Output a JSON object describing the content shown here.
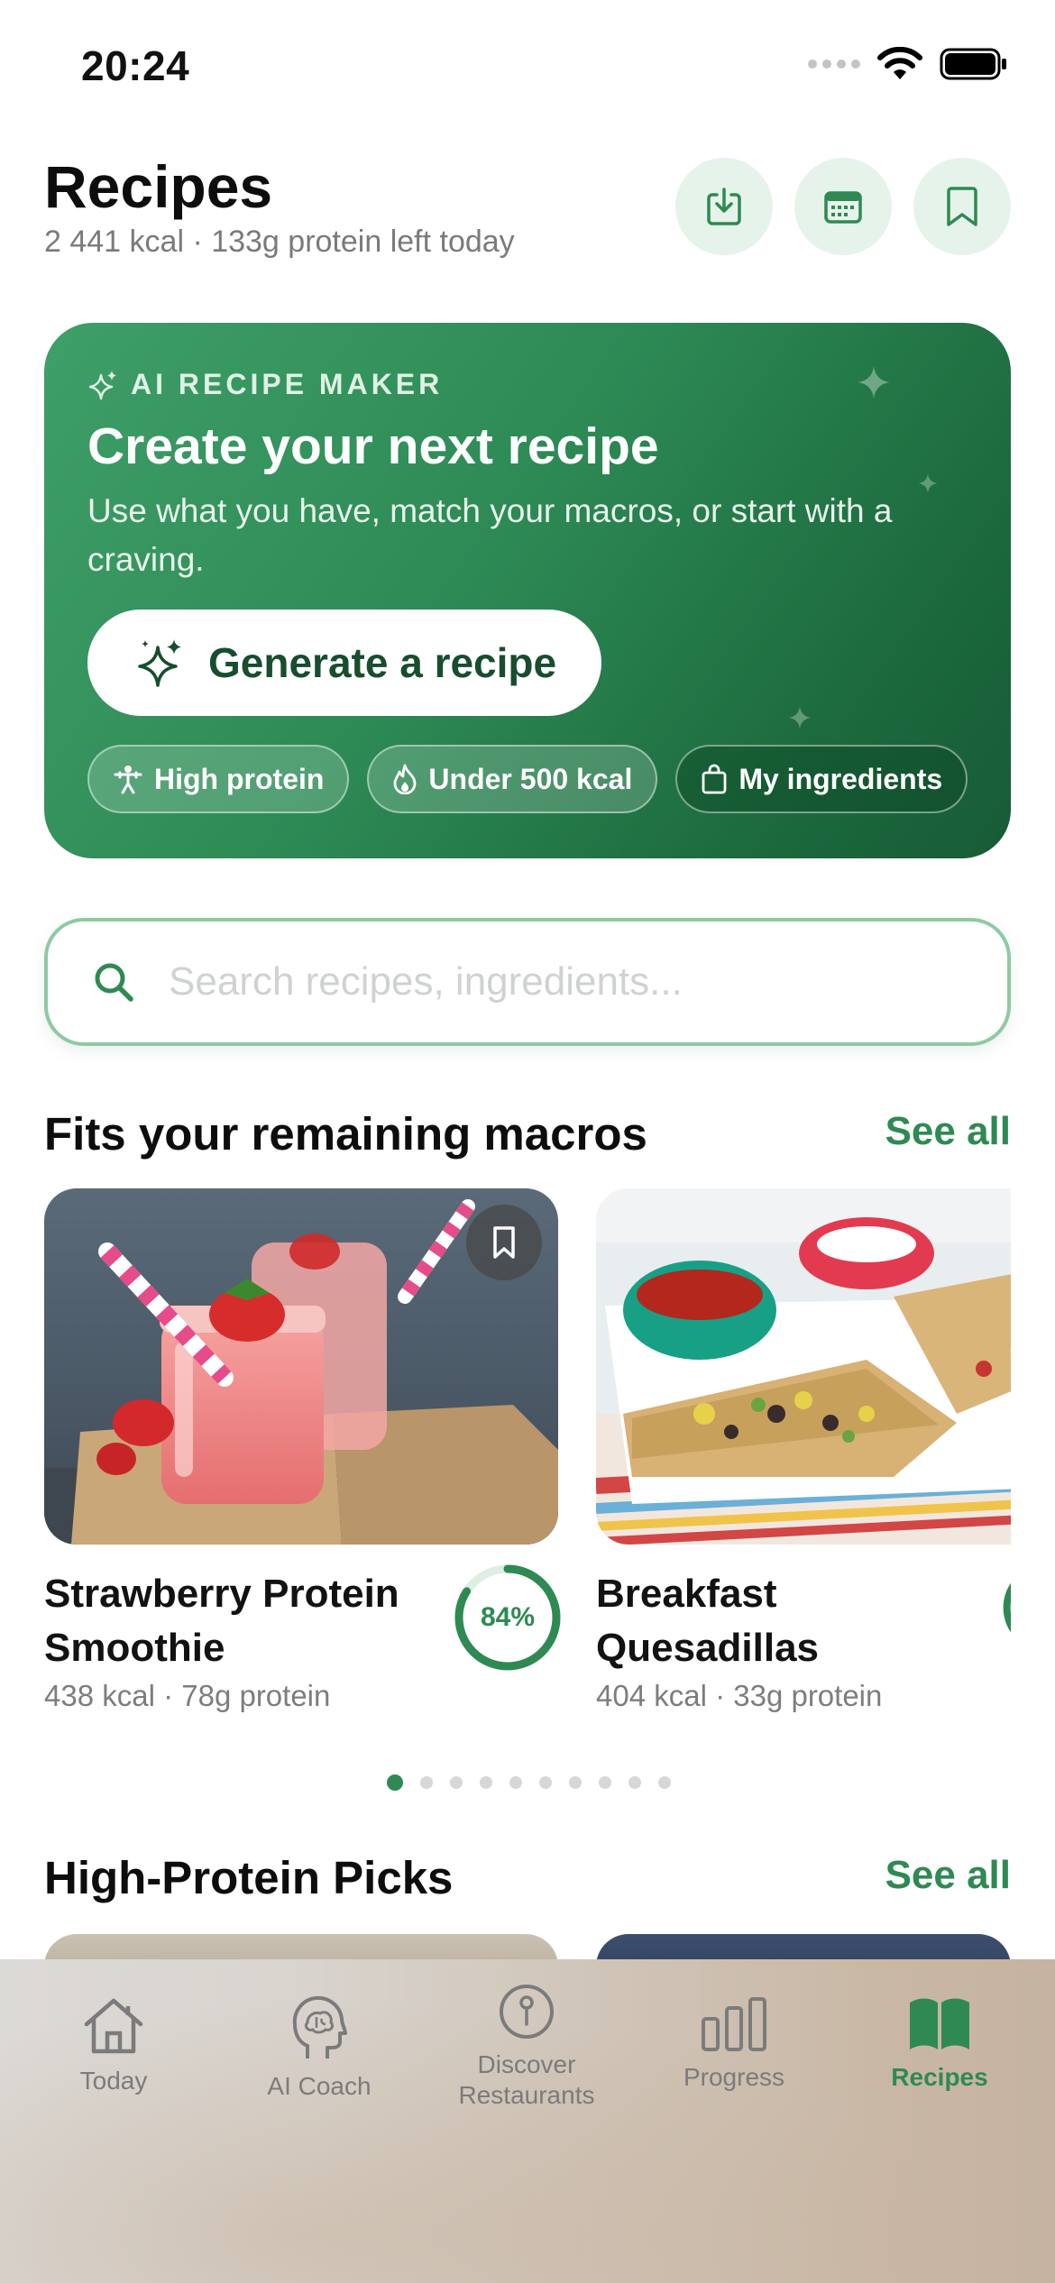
{
  "status_bar": {
    "time": "20:24"
  },
  "header": {
    "title": "Recipes",
    "subtitle": "2 441 kcal · 133g protein left today",
    "actions": [
      {
        "icon": "download-icon"
      },
      {
        "icon": "calendar-icon"
      },
      {
        "icon": "bookmark-icon"
      }
    ]
  },
  "ai_card": {
    "kicker": "AI RECIPE MAKER",
    "title": "Create your next recipe",
    "description": "Use what you have, match your macros, or start with a craving.",
    "button_label": "Generate a recipe",
    "chips": [
      {
        "label": "High protein",
        "icon": "person-lift-icon"
      },
      {
        "label": "Under 500 kcal",
        "icon": "flame-icon"
      },
      {
        "label": "My ingredients",
        "icon": "bag-icon"
      }
    ],
    "colors": {
      "from": "#3f9f68",
      "to": "#175b35"
    }
  },
  "search": {
    "placeholder": "Search recipes, ingredients..."
  },
  "sections": [
    {
      "title": "Fits your remaining macros",
      "see_all": "See all",
      "cards": [
        {
          "title": "Strawberry Protein Smoothie",
          "meta": "438 kcal · 78g protein",
          "match": "84%",
          "match_fraction": 0.84
        },
        {
          "title": "Breakfast Quesadillas",
          "meta": "404 kcal · 33g protein"
        }
      ],
      "page_count": 10,
      "active_page": 0
    },
    {
      "title": "High-Protein Picks",
      "see_all": "See all"
    }
  ],
  "tabbar": {
    "items": [
      {
        "label": "Today",
        "icon": "house-icon",
        "active": false
      },
      {
        "label": "AI Coach",
        "icon": "brain-head-icon",
        "active": false
      },
      {
        "label": "Discover Restaurants",
        "icon": "location-pin-icon",
        "active": false
      },
      {
        "label": "Progress",
        "icon": "bar-chart-icon",
        "active": false
      },
      {
        "label": "Recipes",
        "icon": "open-book-icon",
        "active": true
      }
    ]
  },
  "colors": {
    "accent": "#2e8a52",
    "accent_light": "#e6f3ea"
  }
}
